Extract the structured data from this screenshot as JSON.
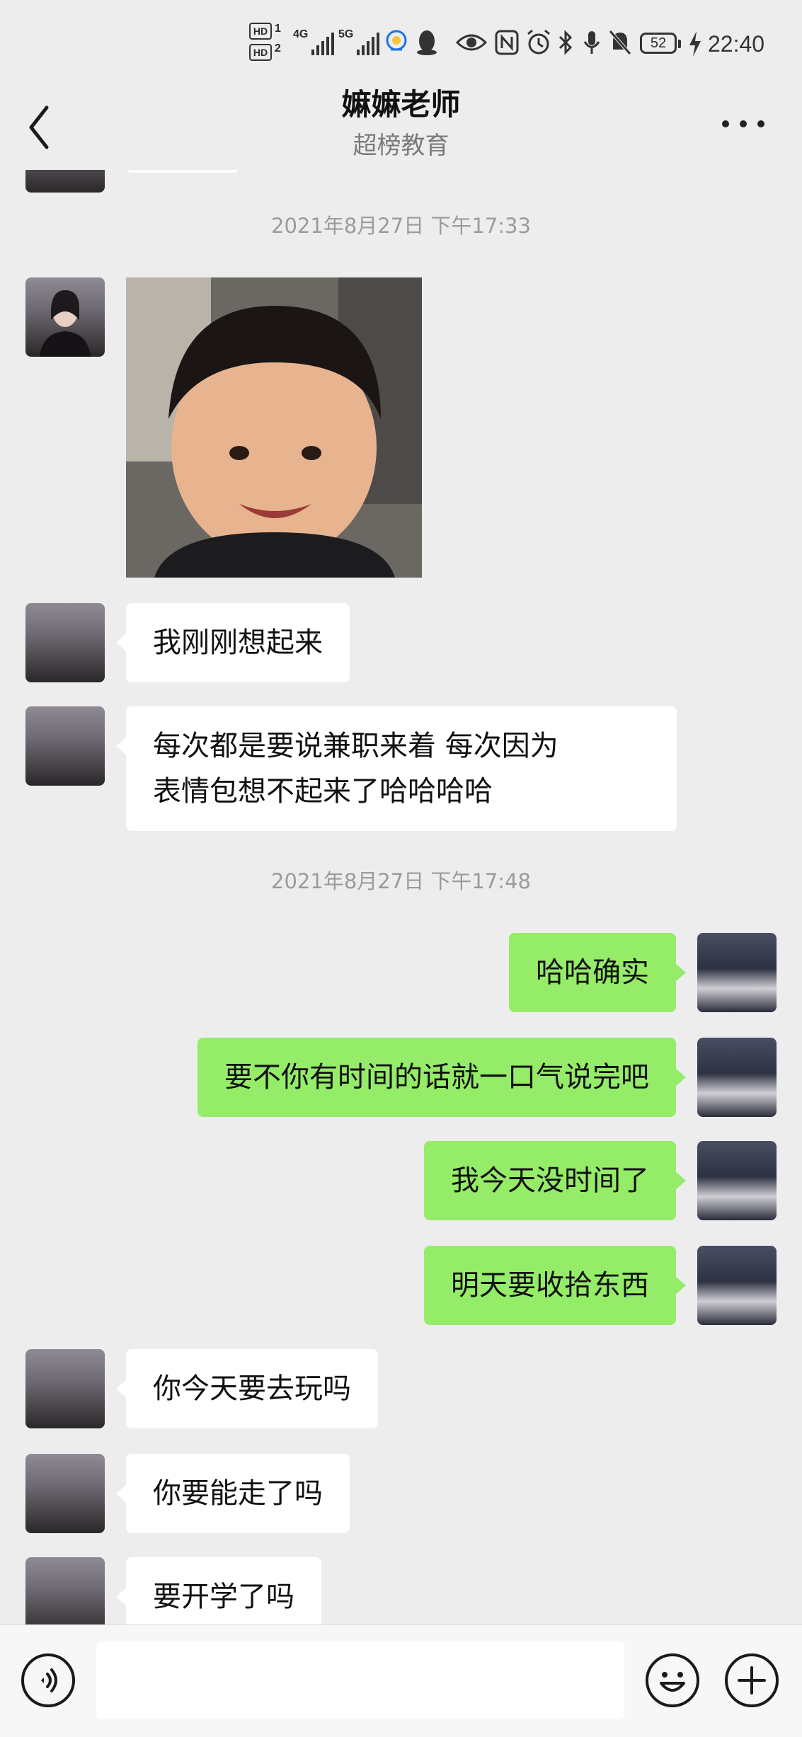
{
  "status_bar": {
    "hd_badges": [
      "HD",
      "HD"
    ],
    "hd_numbers": [
      "1",
      "2"
    ],
    "network_1": "4G",
    "network_2": "5G",
    "battery": "52",
    "time": "22:40",
    "icons": [
      "chat-icon",
      "qq-icon",
      "eye-icon",
      "nfc-icon",
      "alarm-icon",
      "bluetooth-icon",
      "mic-icon",
      "mute-icon",
      "charging-icon"
    ]
  },
  "header": {
    "title": "嫲嫲老师",
    "subtitle": "超榜教育",
    "back_icon": "chevron-left-icon",
    "more_icon": "more-dots-icon"
  },
  "messages": [
    {
      "type": "timestamp",
      "text": "2021年8月27日 下午17:33"
    },
    {
      "type": "image",
      "from": "her",
      "alt_icon": "photo-toddler-smiling"
    },
    {
      "type": "text",
      "from": "her",
      "text": "我刚刚想起来"
    },
    {
      "type": "text",
      "from": "her",
      "lines": [
        "每次都是要说兼职来着  每次因为",
        "表情包想不起来了哈哈哈哈"
      ]
    },
    {
      "type": "timestamp",
      "text": "2021年8月27日 下午17:48"
    },
    {
      "type": "text",
      "from": "me",
      "text": "哈哈确实"
    },
    {
      "type": "text",
      "from": "me",
      "text": "要不你有时间的话就一口气说完吧"
    },
    {
      "type": "text",
      "from": "me",
      "text": "我今天没时间了"
    },
    {
      "type": "text",
      "from": "me",
      "text": "明天要收拾东西"
    },
    {
      "type": "text",
      "from": "her",
      "text": "你今天要去玩吗"
    },
    {
      "type": "text",
      "from": "her",
      "text": "你要能走了吗"
    },
    {
      "type": "text",
      "from": "her",
      "text": "要开学了吗"
    }
  ],
  "input_bar": {
    "voice_icon": "voice-icon",
    "text_value": "",
    "emoji_icon": "emoji-icon",
    "plus_icon": "plus-icon"
  },
  "colors": {
    "background": "#ededed",
    "incoming_bubble": "#ffffff",
    "outgoing_bubble": "#95ec69",
    "timestamp_text": "#9b9b9b"
  }
}
